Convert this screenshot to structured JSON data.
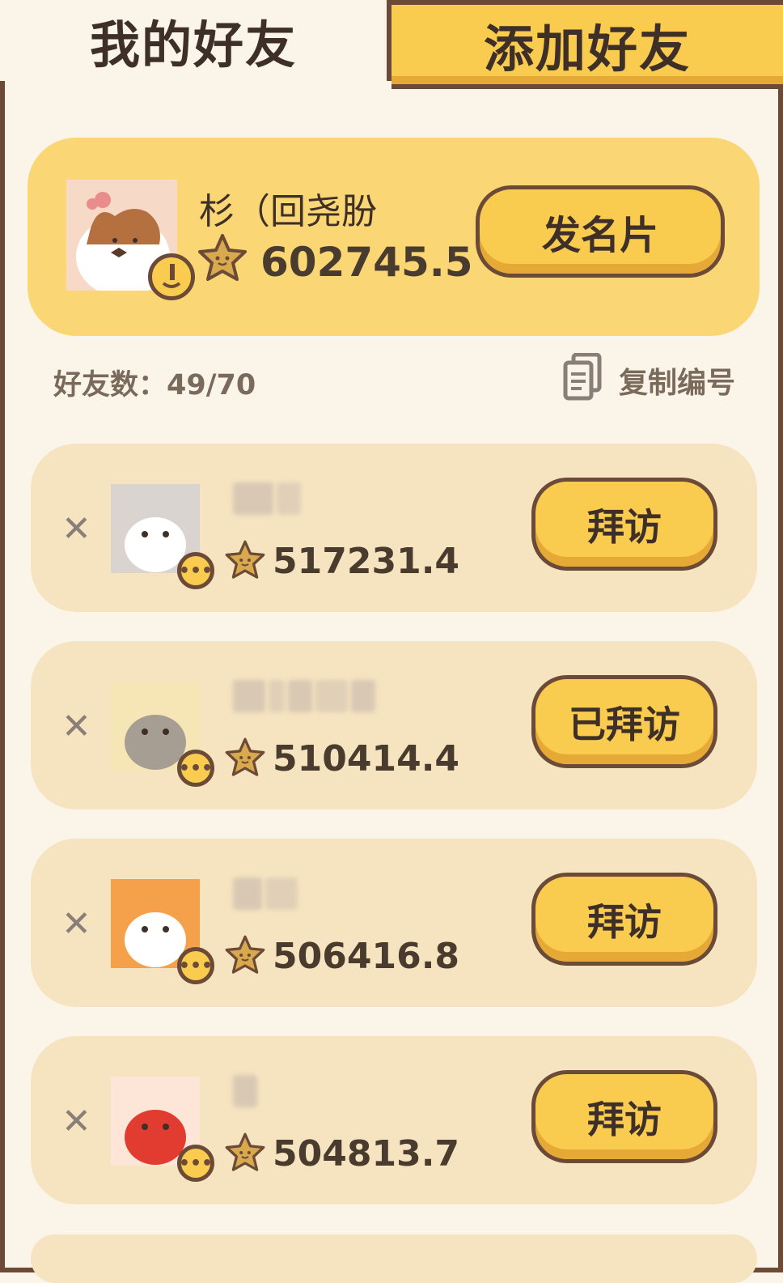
{
  "tabs": {
    "my_friends": "我的好友",
    "add_friends": "添加好友"
  },
  "me": {
    "name": "杉（回尧朌",
    "score": "602745.5",
    "card_button": "发名片"
  },
  "stats": {
    "label": "好友数：49/70",
    "copy_label": "复制编号"
  },
  "friends": [
    {
      "score": "517231.4",
      "action": "拜访"
    },
    {
      "score": "510414.4",
      "action": "已拜访"
    },
    {
      "score": "506416.8",
      "action": "拜访"
    },
    {
      "score": "504813.7",
      "action": "拜访"
    }
  ],
  "icons": {
    "star": "star-icon",
    "more": "more-icon",
    "remove": "close-icon",
    "copy": "copy-icon",
    "edit": "edit-icon"
  },
  "colors": {
    "accent": "#f9cb4f",
    "border": "#6b4a37",
    "background": "#fbf4e8"
  }
}
